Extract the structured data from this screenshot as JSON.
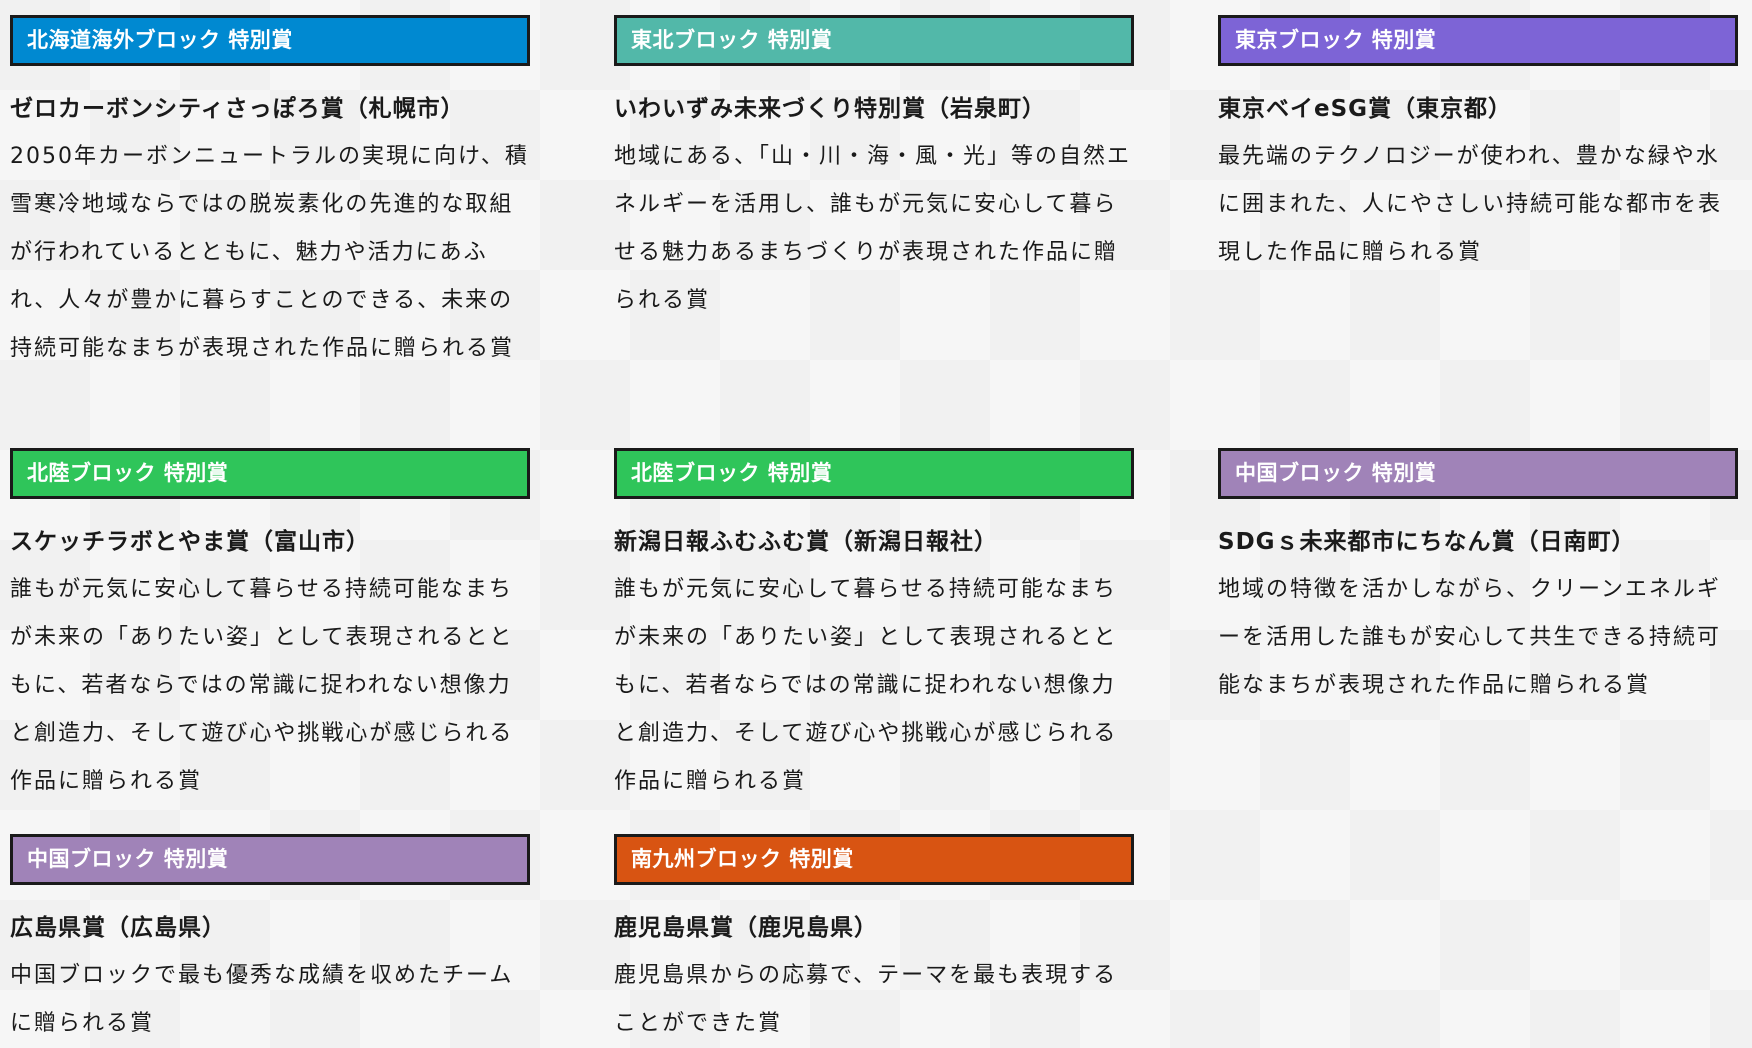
{
  "colors": {
    "blue": "#0089d1",
    "teal": "#52b8a9",
    "violet": "#7d64d6",
    "green": "#2fc55a",
    "purple": "#a083b8",
    "orange": "#d85412"
  },
  "cards": [
    {
      "badge": "北海道海外ブロック 特別賞",
      "color": "#0089d1",
      "award": "ゼロカーボンシティさっぽろ賞（札幌市）",
      "desc": "2050年カーボンニュートラルの実現に向け、積雪寒冷地域ならではの脱炭素化の先進的な取組が行われているとともに、魅力や活力にあふれ、人々が豊かに暮らすことのできる、未来の持続可能なまちが表現された作品に贈られる賞"
    },
    {
      "badge": "東北ブロック 特別賞",
      "color": "#52b8a9",
      "award": "いわいずみ未来づくり特別賞（岩泉町）",
      "desc": "地域にある、「山・川・海・風・光」等の自然エネルギーを活用し、誰もが元気に安心して暮らせる魅力あるまちづくりが表現された作品に贈られる賞"
    },
    {
      "badge": "東京ブロック 特別賞",
      "color": "#7d64d6",
      "award": "東京ベイeSG賞（東京都）",
      "desc": "最先端のテクノロジーが使われ、豊かな緑や水に囲まれた、人にやさしい持続可能な都市を表現した作品に贈られる賞"
    },
    {
      "badge": "北陸ブロック 特別賞",
      "color": "#2fc55a",
      "award": "スケッチラボとやま賞（富山市）",
      "desc": "誰もが元気に安心して暮らせる持続可能なまちが未来の「ありたい姿」として表現されるとともに、若者ならではの常識に捉われない想像力と創造力、そして遊び心や挑戦心が感じられる作品に贈られる賞"
    },
    {
      "badge": "北陸ブロック 特別賞",
      "color": "#2fc55a",
      "award": "新潟日報ふむふむ賞（新潟日報社）",
      "desc": "誰もが元気に安心して暮らせる持続可能なまちが未来の「ありたい姿」として表現されるとともに、若者ならではの常識に捉われない想像力と創造力、そして遊び心や挑戦心が感じられる作品に贈られる賞"
    },
    {
      "badge": "中国ブロック 特別賞",
      "color": "#a083b8",
      "award": "SDGｓ未来都市にちなん賞（日南町）",
      "desc": "地域の特徴を活かしながら、クリーンエネルギーを活用した誰もが安心して共生できる持続可能なまちが表現された作品に贈られる賞"
    },
    {
      "badge": "中国ブロック 特別賞",
      "color": "#a083b8",
      "award": "広島県賞（広島県）",
      "desc": "中国ブロックで最も優秀な成績を収めたチームに贈られる賞"
    },
    {
      "badge": "南九州ブロック 特別賞",
      "color": "#d85412",
      "award": "鹿児島県賞（鹿児島県）",
      "desc": "鹿児島県からの応募で、テーマを最も表現することができた賞"
    }
  ]
}
